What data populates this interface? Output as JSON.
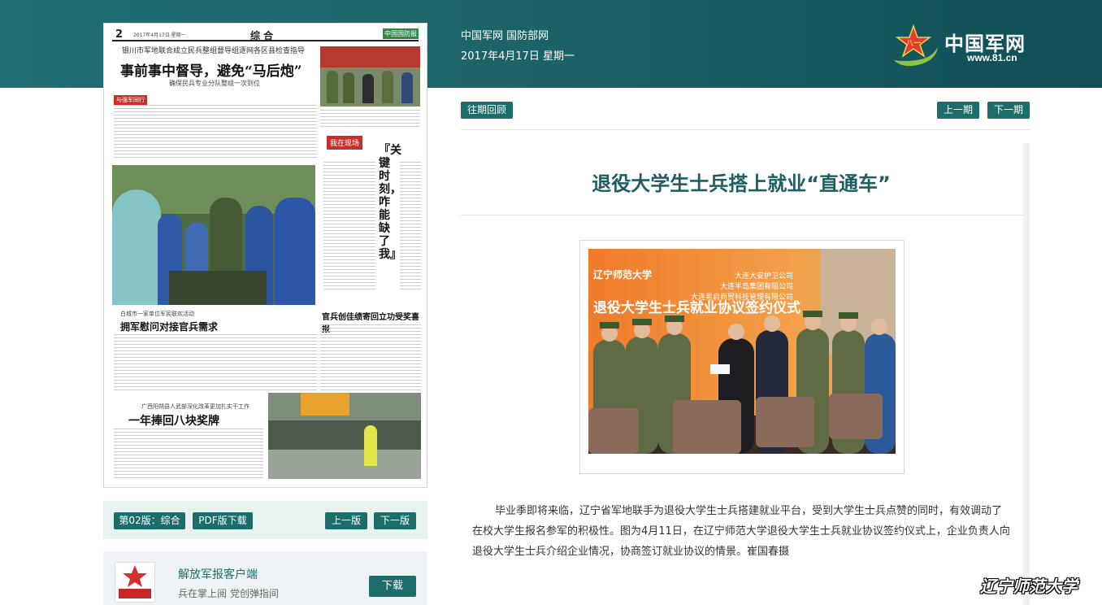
{
  "header": {
    "site_line": "中国军网 国防部网",
    "date_line": "2017年4月17日 星期一",
    "logo_text": "中国军网",
    "logo_url": "www.81.cn"
  },
  "paper": {
    "page_no": "2",
    "page_date": "2017年4月17日 星期一",
    "section": "综 合",
    "brand": "中国国防报",
    "kicker": "银川市军地联合成立民兵整组督导组逐网各区县检查指导",
    "headline": "事前事中督导，避免“马后炮”",
    "subhead": "确保民兵专业分队整组一次到位",
    "tag_red": "与强军同行",
    "vertical_title": "『关键时刻，咋能缺了我』",
    "tag_column": "我在现场",
    "story2_kicker": "白城市一家单位军民联欢活动",
    "story2_title": "拥军慰问对接官兵需求",
    "story3_title": "官兵创佳绩寄回立功受奖喜报",
    "story4_kicker": "广西阳朔县人武部深化改革更加扎实干工作",
    "story4_title": "一年捧回八块奖牌"
  },
  "pager": {
    "page_label": "第02版：综合",
    "pdf_label": "PDF版下载",
    "prev_page": "上一版",
    "next_page": "下一版"
  },
  "app": {
    "name": "解放军报客户端",
    "desc": "兵在掌上阅 党创弹指间",
    "download": "下载"
  },
  "nav": {
    "archive": "往期回顾",
    "prev_issue": "上一期",
    "next_issue": "下一期"
  },
  "article": {
    "title": "退役大学生士兵搭上就业“直通车”",
    "photo_banner_left": "辽宁师范大学",
    "photo_banner_main": "退役大学生士兵就业协议签约仪式",
    "photo_company_1": "大连大安护卫公司",
    "photo_company_2": "大连半岛集团有限公司",
    "photo_company_3": "大连易启商贸科技管理有限公司",
    "paragraph": "毕业季即将来临，辽宁省军地联手为退役大学生士兵搭建就业平台，受到大学生士兵点赞的同时，有效调动了在校大学生报名参军的积极性。图为4月11日，在辽宁师范大学退役大学生士兵就业协议签约仪式上，企业负责人向退役大学生士兵介绍企业情况，协商签订就业协议的情景。崔国春摄"
  },
  "watermark": "辽宁师范大学",
  "colors": {
    "brand_teal": "#1d6e6a",
    "header_teal": "#1f6e72",
    "title_teal": "#1d5e62"
  }
}
